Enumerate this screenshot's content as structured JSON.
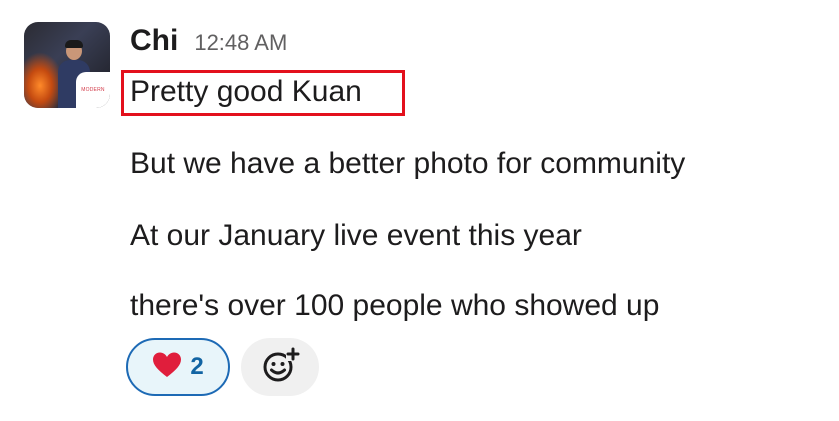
{
  "message": {
    "author": "Chi",
    "time": "12:48 AM",
    "avatar_badge_text": "MODERN",
    "lines": [
      "Pretty good Kuan",
      "But we have a better photo for community",
      "At our January live event this year",
      "there's over 100 people who showed up"
    ]
  },
  "reactions": [
    {
      "icon": "heart-icon",
      "emoji": "❤️",
      "count": "2"
    }
  ],
  "add_reaction_icon": "add-reaction-icon",
  "colors": {
    "highlight": "#e3101c",
    "reaction_border": "#1d6ab5",
    "reaction_bg": "#e8f5fa",
    "count_text": "#1264a3"
  }
}
